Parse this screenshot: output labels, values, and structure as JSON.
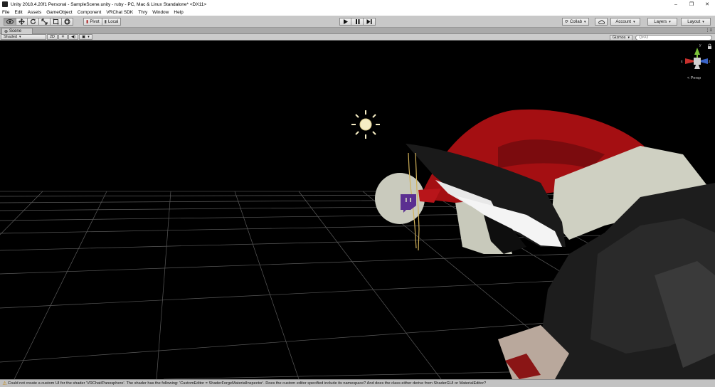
{
  "window": {
    "title": "Unity 2018.4.20f1 Personal - SampleScene.unity - ruby - PC, Mac & Linux Standalone* <DX11>",
    "minimize": "–",
    "restore": "❐",
    "close": "✕"
  },
  "menu": [
    "File",
    "Edit",
    "Assets",
    "GameObject",
    "Component",
    "VRChat SDK",
    "Thry",
    "Window",
    "Help"
  ],
  "toolbar": {
    "transform_tools": [
      "view-tool",
      "move-tool",
      "rotate-tool",
      "scale-tool",
      "rect-tool",
      "transform-tool"
    ],
    "pivot_label": "Pivot",
    "local_label": "Local",
    "collab_label": "Collab",
    "account_label": "Account",
    "layers_label": "Layers",
    "layout_label": "Layout"
  },
  "scene": {
    "tab_label": "Scene",
    "tab_menu": "⋮≡",
    "shading_mode": "Shaded",
    "mode_2d": "2D",
    "gizmos_label": "Gizmos",
    "search_placeholder": "Q▾All",
    "persp_label": "< Persp",
    "axis_x": "x",
    "axis_y": "y",
    "axis_z": "z"
  },
  "status": {
    "message": "Could not create a custom UI for the shader 'VRChat/Panosphere'. The shader has the following: 'CustomEditor = ShaderForgeMaterialInspector'. Does the custom editor specified include its namespace? And does the class either derive from ShaderGUI or MaterialEditor?"
  },
  "colors": {
    "hat_red": "#a40f12",
    "hat_fur": "#cfd0c2",
    "hair": "#1a1a1a",
    "twitch_purple": "#5b2f91",
    "gizmo_y": "#7cc43a",
    "gizmo_x": "#c8302c",
    "gizmo_z": "#3a64c8"
  }
}
